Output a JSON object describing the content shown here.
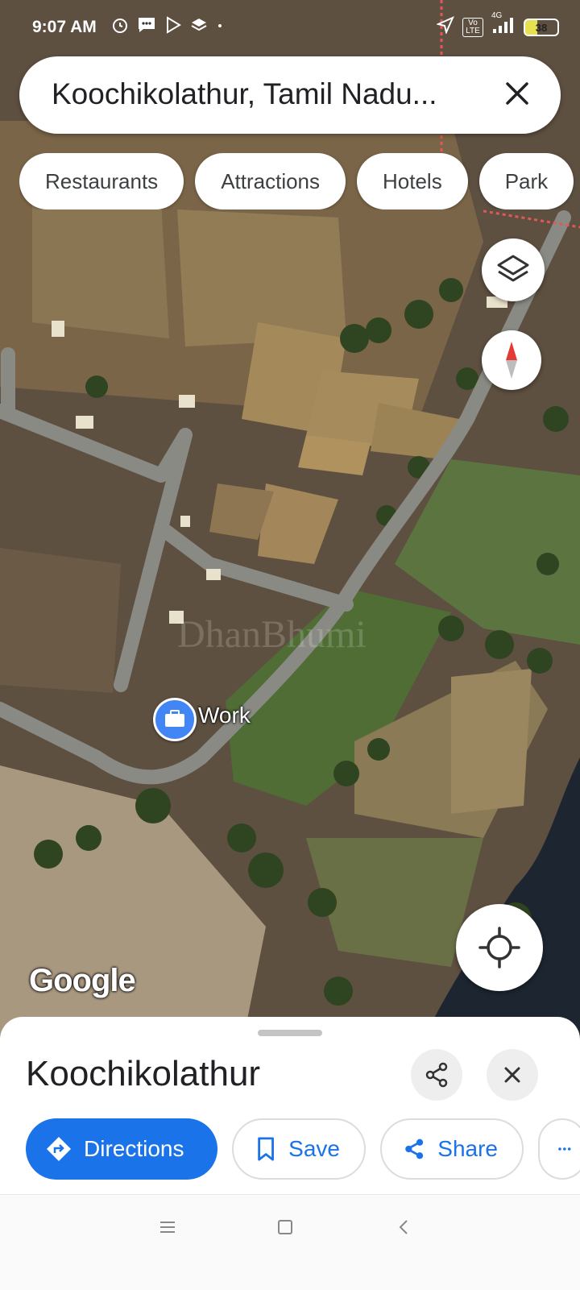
{
  "status_bar": {
    "time": "9:07 AM",
    "battery": "38",
    "network": "4G",
    "lte": "Vo LTE"
  },
  "search": {
    "query": "Koochikolathur, Tamil Nadu..."
  },
  "chips": [
    "Restaurants",
    "Attractions",
    "Hotels",
    "Park"
  ],
  "map": {
    "attribution": "Google",
    "watermark": "DhanBhumi",
    "pin_label": "Work"
  },
  "place_sheet": {
    "title": "Koochikolathur",
    "actions": [
      {
        "label": "Directions"
      },
      {
        "label": "Save"
      },
      {
        "label": "Share"
      }
    ]
  },
  "colors": {
    "accent": "#1a73e8",
    "road": "#8a8a84",
    "compass_red": "#e53935"
  }
}
